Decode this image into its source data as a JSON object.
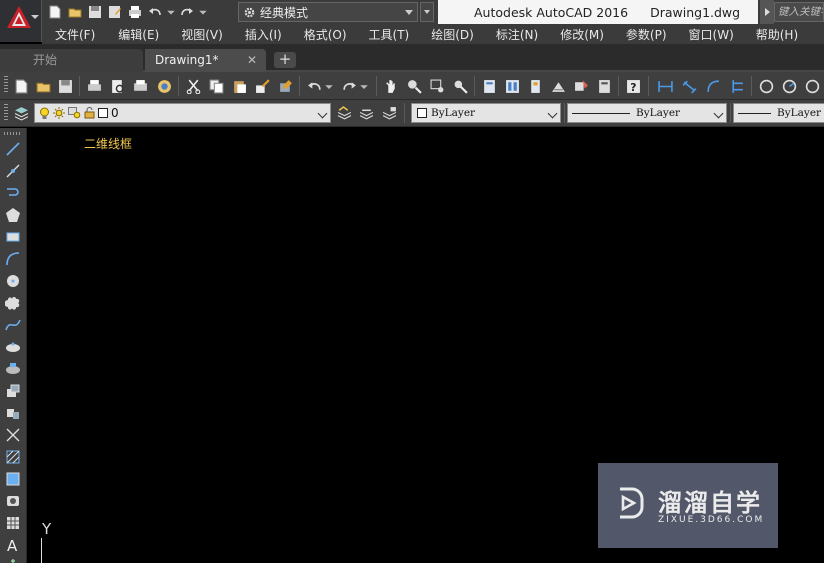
{
  "titlebar": {
    "workspace": "经典模式",
    "product": "Autodesk AutoCAD 2016",
    "document": "Drawing1.dwg",
    "search_placeholder": "键入关键字或短语"
  },
  "menu": {
    "items": [
      "文件(F)",
      "编辑(E)",
      "视图(V)",
      "插入(I)",
      "格式(O)",
      "工具(T)",
      "绘图(D)",
      "标注(N)",
      "修改(M)",
      "参数(P)",
      "窗口(W)",
      "帮助(H)"
    ]
  },
  "tabs": [
    {
      "label": "开始",
      "active": false
    },
    {
      "label": "Drawing1*",
      "active": true
    }
  ],
  "layer_toolbar": {
    "current_layer": "0",
    "color": "ByLayer",
    "linetype": "ByLayer",
    "lineweight": "ByLayer"
  },
  "canvas": {
    "view_label": "二维线框",
    "ucs_y": "Y"
  },
  "watermark": {
    "title": "溜溜自学",
    "url": "ZIXUE.3D66.COM"
  },
  "colors": {
    "background": "#000000",
    "panel": "#3f3f3f",
    "view_label": "#f0c850",
    "app_logo": "#c9202a"
  }
}
